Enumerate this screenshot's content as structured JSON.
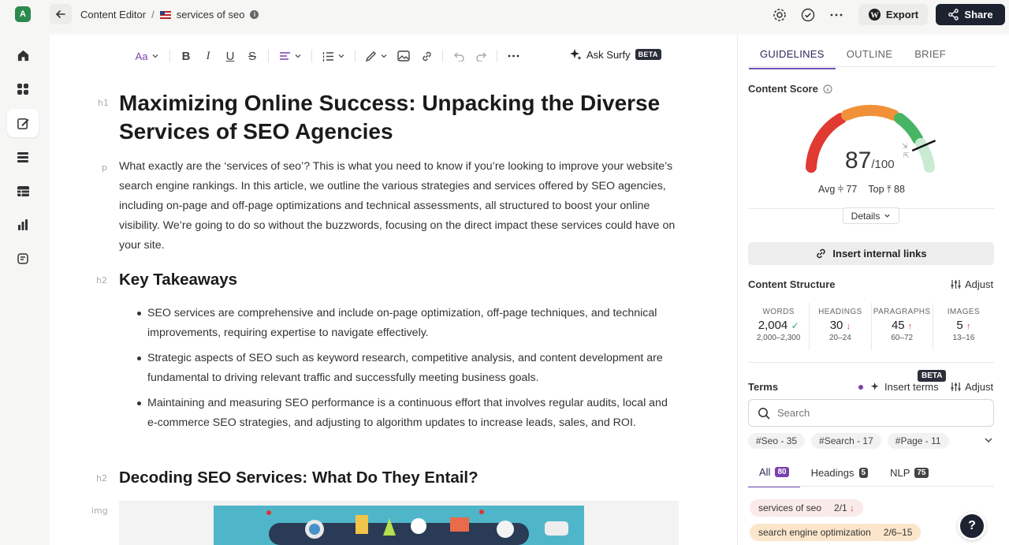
{
  "app": {
    "avatar_letter": "A"
  },
  "header": {
    "breadcrumb_root": "Content Editor",
    "breadcrumb_sep": "/",
    "document_name": "services of seo",
    "export_label": "Export",
    "share_label": "Share"
  },
  "toolbar": {
    "font_label": "Aa",
    "ask_surfy": "Ask Surfy",
    "beta": "BETA"
  },
  "document": {
    "h1_tag": "h1",
    "title": "Maximizing Online Success: Unpacking the Diverse Services of SEO Agencies",
    "p_tag": "p",
    "intro": "What exactly are the ‘services of seo’? This is what you need to know if you’re looking to improve your website’s search engine rankings. In this article, we outline the various strategies and services offered by SEO agencies, including on-page and off-page optimizations and technical assessments, all structured to boost your online visibility. We’re going to do so without the buzzwords, focusing on the direct impact these services could have on your site.",
    "h2_tag": "h2",
    "heading_takeaways": "Key Takeaways",
    "bullets": [
      "SEO services are comprehensive and include on-page optimization, off-page techniques, and technical improvements, requiring expertise to navigate effectively.",
      "Strategic aspects of SEO such as keyword research, competitive analysis, and content development are fundamental to driving relevant traffic and successfully meeting business goals.",
      "Maintaining and measuring SEO performance is a continuous effort that involves regular audits, local and e-commerce SEO strategies, and adjusting to algorithm updates to increase leads, sales, and ROI."
    ],
    "heading_decoding": "Decoding SEO Services: What Do They Entail?",
    "img_tag": "img"
  },
  "panel": {
    "tabs": [
      "GUIDELINES",
      "OUTLINE",
      "BRIEF"
    ],
    "content_score_label": "Content Score",
    "score": "87",
    "score_max": "/100",
    "score_value": 0.87,
    "avg_label": "Avg",
    "avg_value": "77",
    "top_label": "Top",
    "top_value": "88",
    "details_label": "Details",
    "insert_links": "Insert internal links",
    "structure_label": "Content Structure",
    "adjust_label": "Adjust",
    "stats": [
      {
        "label": "WORDS",
        "value": "2,004",
        "range": "2,000–2,300",
        "status": "ok"
      },
      {
        "label": "HEADINGS",
        "value": "30",
        "range": "20–24",
        "status": "down"
      },
      {
        "label": "PARAGRAPHS",
        "value": "45",
        "range": "60–72",
        "status": "up"
      },
      {
        "label": "IMAGES",
        "value": "5",
        "range": "13–16",
        "status": "up"
      }
    ],
    "terms_label": "Terms",
    "terms_beta": "BETA",
    "insert_terms": "Insert terms",
    "search_placeholder": "Search",
    "chips": [
      "#Seo - 35",
      "#Search - 17",
      "#Page - 11"
    ],
    "term_tabs": [
      {
        "label": "All",
        "count": "80"
      },
      {
        "label": "Headings",
        "count": "5"
      },
      {
        "label": "NLP",
        "count": "75"
      }
    ],
    "terms": [
      {
        "text": "services of seo",
        "count": "2/1"
      },
      {
        "text": "search engine optimization",
        "count": "2/6–15"
      }
    ],
    "help": "?"
  },
  "colors": {
    "accent": "#6f51b8",
    "gauge_red": "#e03a33",
    "gauge_orange": "#f0913a",
    "gauge_green": "#48b565",
    "dark": "#1c2230"
  }
}
